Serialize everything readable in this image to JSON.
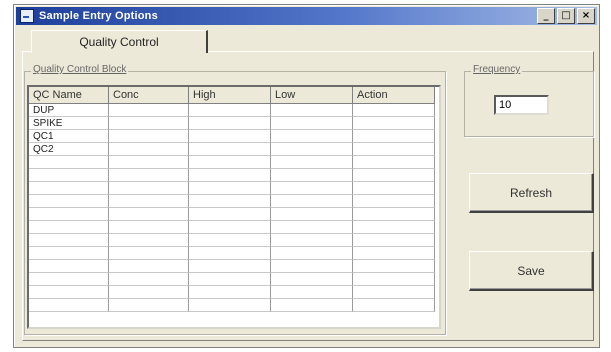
{
  "window": {
    "title": "Sample Entry Options",
    "controls": [
      "_",
      "□",
      "×"
    ]
  },
  "tabs": [
    {
      "label": "Quality Control",
      "selected": true
    }
  ],
  "quality_control": {
    "group_title": "Quality Control Block",
    "columns": [
      "QC Name",
      "Conc",
      "High",
      "Low",
      "Action"
    ],
    "rows": [
      [
        "DUP",
        "",
        "",
        "",
        ""
      ],
      [
        "SPIKE",
        "",
        "",
        "",
        ""
      ],
      [
        "QC1",
        "",
        "",
        "",
        ""
      ],
      [
        "QC2",
        "",
        "",
        "",
        ""
      ],
      [
        "",
        "",
        "",
        "",
        ""
      ],
      [
        "",
        "",
        "",
        "",
        ""
      ],
      [
        "",
        "",
        "",
        "",
        ""
      ],
      [
        "",
        "",
        "",
        "",
        ""
      ],
      [
        "",
        "",
        "",
        "",
        ""
      ],
      [
        "",
        "",
        "",
        "",
        ""
      ],
      [
        "",
        "",
        "",
        "",
        ""
      ],
      [
        "",
        "",
        "",
        "",
        ""
      ],
      [
        "",
        "",
        "",
        "",
        ""
      ],
      [
        "",
        "",
        "",
        "",
        ""
      ],
      [
        "",
        "",
        "",
        "",
        ""
      ],
      [
        "",
        "",
        "",
        "",
        ""
      ]
    ]
  },
  "frequency": {
    "label": "Frequency",
    "value": "10"
  },
  "buttons": {
    "refresh": "Refresh",
    "save": "Save"
  }
}
